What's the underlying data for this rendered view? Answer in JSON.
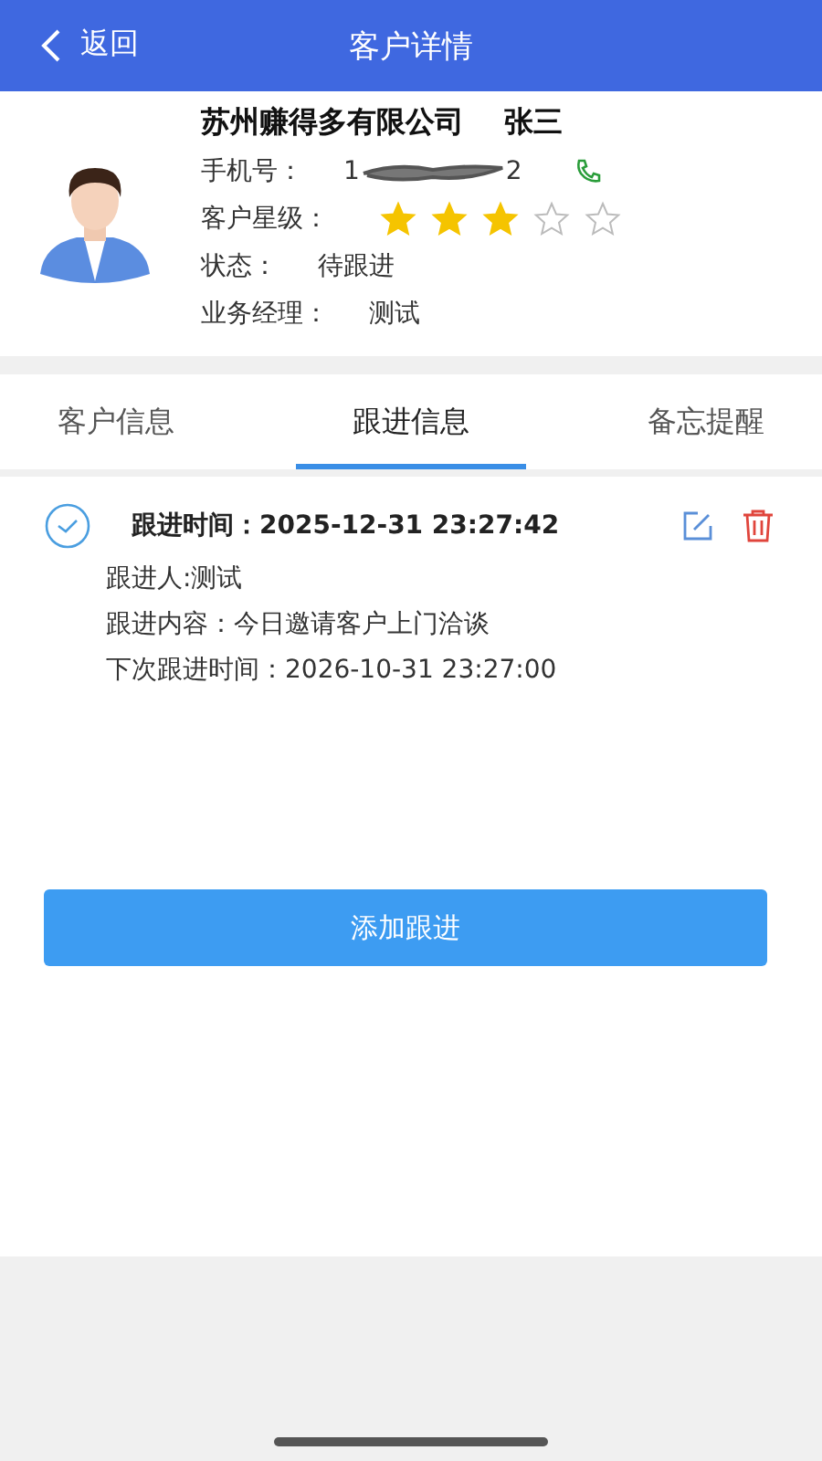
{
  "nav": {
    "back": "返回",
    "title": "客户详情"
  },
  "customer": {
    "name": "苏州赚得多有限公司",
    "contact": "张三",
    "fields": [
      {
        "kind": "phone",
        "label": "手机号：",
        "value_start": "1",
        "value_end": "2"
      },
      {
        "kind": "stars",
        "label": "客户星级：",
        "stars": 3
      },
      {
        "kind": "text",
        "label": "状态：",
        "value": "待跟进"
      },
      {
        "kind": "text",
        "label": "业务经理：",
        "value": "测试"
      }
    ]
  },
  "tabs": [
    {
      "label": "客户信息",
      "selected": false
    },
    {
      "label": "跟进信息",
      "selected": true
    },
    {
      "label": "备忘提醒",
      "selected": false
    }
  ],
  "records": [
    {
      "checked": true,
      "time_label": "跟进时间：",
      "time": "2025-12-31 23:27:42",
      "lines": [
        "跟进人:测试",
        "跟进内容：今日邀请客户上门洽谈",
        "下次跟进时间：2026-10-31 23:27:00"
      ]
    }
  ],
  "add_button": "添加跟进"
}
